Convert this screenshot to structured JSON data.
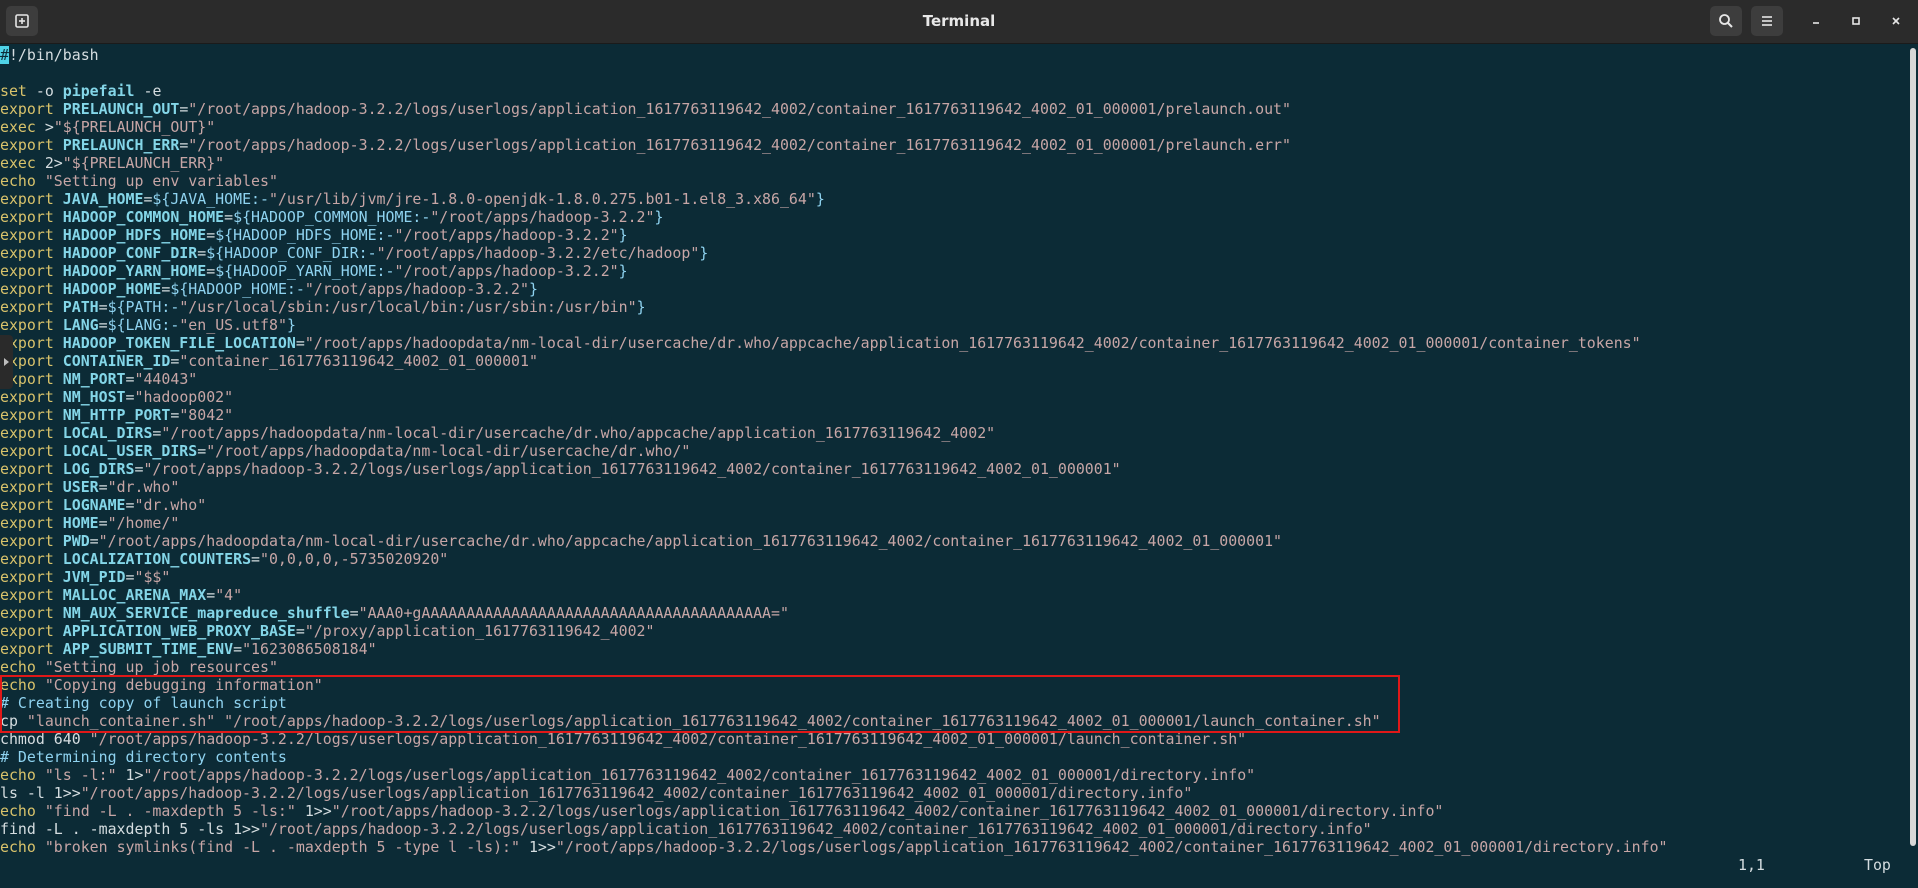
{
  "window": {
    "title": "Terminal"
  },
  "icons": {
    "new_tab": "new-tab-icon",
    "search": "search-icon",
    "menu": "menu-icon",
    "minimize": "minimize-icon",
    "maximize": "maximize-icon",
    "close": "close-icon"
  },
  "colors": {
    "background": "#0c2b36",
    "keyword": "#d9c36b",
    "variable": "#84d6e8",
    "string": "#c7a6a6",
    "comment": "#8fd3f0",
    "highlight_box": "#e01818"
  },
  "script_lines": [
    [
      [
        "cursor",
        "#"
      ],
      [
        "txt",
        "!/bin/bash"
      ]
    ],
    [],
    [
      [
        "kw",
        "set"
      ],
      [
        "txt",
        " -o "
      ],
      [
        "var",
        "pipefail"
      ],
      [
        "txt",
        " -e"
      ]
    ],
    [
      [
        "kw",
        "export"
      ],
      [
        "txt",
        " "
      ],
      [
        "var",
        "PRELAUNCH_OUT"
      ],
      [
        "txt",
        "="
      ],
      [
        "str",
        "\"/root/apps/hadoop-3.2.2/logs/userlogs/application_1617763119642_4002/container_1617763119642_4002_01_000001/prelaunch.out\""
      ]
    ],
    [
      [
        "kw",
        "exec"
      ],
      [
        "txt",
        " >"
      ],
      [
        "str",
        "\"${PRELAUNCH_OUT}\""
      ]
    ],
    [
      [
        "kw",
        "export"
      ],
      [
        "txt",
        " "
      ],
      [
        "var",
        "PRELAUNCH_ERR"
      ],
      [
        "txt",
        "="
      ],
      [
        "str",
        "\"/root/apps/hadoop-3.2.2/logs/userlogs/application_1617763119642_4002/container_1617763119642_4002_01_000001/prelaunch.err\""
      ]
    ],
    [
      [
        "kw",
        "exec"
      ],
      [
        "txt",
        " 2>"
      ],
      [
        "str",
        "\"${PRELAUNCH_ERR}\""
      ]
    ],
    [
      [
        "kw",
        "echo"
      ],
      [
        "txt",
        " "
      ],
      [
        "str",
        "\"Setting up env variables\""
      ]
    ],
    [
      [
        "kw",
        "export"
      ],
      [
        "txt",
        " "
      ],
      [
        "var",
        "JAVA_HOME"
      ],
      [
        "txt",
        "="
      ],
      [
        "ref",
        "${JAVA_HOME:-"
      ],
      [
        "str",
        "\"/usr/lib/jvm/jre-1.8.0-openjdk-1.8.0.275.b01-1.el8_3.x86_64\""
      ],
      [
        "ref",
        "}"
      ]
    ],
    [
      [
        "kw",
        "export"
      ],
      [
        "txt",
        " "
      ],
      [
        "var",
        "HADOOP_COMMON_HOME"
      ],
      [
        "txt",
        "="
      ],
      [
        "ref",
        "${HADOOP_COMMON_HOME:-"
      ],
      [
        "str",
        "\"/root/apps/hadoop-3.2.2\""
      ],
      [
        "ref",
        "}"
      ]
    ],
    [
      [
        "kw",
        "export"
      ],
      [
        "txt",
        " "
      ],
      [
        "var",
        "HADOOP_HDFS_HOME"
      ],
      [
        "txt",
        "="
      ],
      [
        "ref",
        "${HADOOP_HDFS_HOME:-"
      ],
      [
        "str",
        "\"/root/apps/hadoop-3.2.2\""
      ],
      [
        "ref",
        "}"
      ]
    ],
    [
      [
        "kw",
        "export"
      ],
      [
        "txt",
        " "
      ],
      [
        "var",
        "HADOOP_CONF_DIR"
      ],
      [
        "txt",
        "="
      ],
      [
        "ref",
        "${HADOOP_CONF_DIR:-"
      ],
      [
        "str",
        "\"/root/apps/hadoop-3.2.2/etc/hadoop\""
      ],
      [
        "ref",
        "}"
      ]
    ],
    [
      [
        "kw",
        "export"
      ],
      [
        "txt",
        " "
      ],
      [
        "var",
        "HADOOP_YARN_HOME"
      ],
      [
        "txt",
        "="
      ],
      [
        "ref",
        "${HADOOP_YARN_HOME:-"
      ],
      [
        "str",
        "\"/root/apps/hadoop-3.2.2\""
      ],
      [
        "ref",
        "}"
      ]
    ],
    [
      [
        "kw",
        "export"
      ],
      [
        "txt",
        " "
      ],
      [
        "var",
        "HADOOP_HOME"
      ],
      [
        "txt",
        "="
      ],
      [
        "ref",
        "${HADOOP_HOME:-"
      ],
      [
        "str",
        "\"/root/apps/hadoop-3.2.2\""
      ],
      [
        "ref",
        "}"
      ]
    ],
    [
      [
        "kw",
        "export"
      ],
      [
        "txt",
        " "
      ],
      [
        "var",
        "PATH"
      ],
      [
        "txt",
        "="
      ],
      [
        "ref",
        "${PATH:-"
      ],
      [
        "str",
        "\"/usr/local/sbin:/usr/local/bin:/usr/sbin:/usr/bin\""
      ],
      [
        "ref",
        "}"
      ]
    ],
    [
      [
        "kw",
        "export"
      ],
      [
        "txt",
        " "
      ],
      [
        "var",
        "LANG"
      ],
      [
        "txt",
        "="
      ],
      [
        "ref",
        "${LANG:-"
      ],
      [
        "str",
        "\"en_US.utf8\""
      ],
      [
        "ref",
        "}"
      ]
    ],
    [
      [
        "kw",
        "export"
      ],
      [
        "txt",
        " "
      ],
      [
        "var",
        "HADOOP_TOKEN_FILE_LOCATION"
      ],
      [
        "txt",
        "="
      ],
      [
        "str",
        "\"/root/apps/hadoopdata/nm-local-dir/usercache/dr.who/appcache/application_1617763119642_4002/container_1617763119642_4002_01_000001/container_tokens\""
      ]
    ],
    [
      [
        "kw",
        "export"
      ],
      [
        "txt",
        " "
      ],
      [
        "var",
        "CONTAINER_ID"
      ],
      [
        "txt",
        "="
      ],
      [
        "str",
        "\"container_1617763119642_4002_01_000001\""
      ]
    ],
    [
      [
        "kw",
        "export"
      ],
      [
        "txt",
        " "
      ],
      [
        "var",
        "NM_PORT"
      ],
      [
        "txt",
        "="
      ],
      [
        "str",
        "\"44043\""
      ]
    ],
    [
      [
        "kw",
        "export"
      ],
      [
        "txt",
        " "
      ],
      [
        "var",
        "NM_HOST"
      ],
      [
        "txt",
        "="
      ],
      [
        "str",
        "\"hadoop002\""
      ]
    ],
    [
      [
        "kw",
        "export"
      ],
      [
        "txt",
        " "
      ],
      [
        "var",
        "NM_HTTP_PORT"
      ],
      [
        "txt",
        "="
      ],
      [
        "str",
        "\"8042\""
      ]
    ],
    [
      [
        "kw",
        "export"
      ],
      [
        "txt",
        " "
      ],
      [
        "var",
        "LOCAL_DIRS"
      ],
      [
        "txt",
        "="
      ],
      [
        "str",
        "\"/root/apps/hadoopdata/nm-local-dir/usercache/dr.who/appcache/application_1617763119642_4002\""
      ]
    ],
    [
      [
        "kw",
        "export"
      ],
      [
        "txt",
        " "
      ],
      [
        "var",
        "LOCAL_USER_DIRS"
      ],
      [
        "txt",
        "="
      ],
      [
        "str",
        "\"/root/apps/hadoopdata/nm-local-dir/usercache/dr.who/\""
      ]
    ],
    [
      [
        "kw",
        "export"
      ],
      [
        "txt",
        " "
      ],
      [
        "var",
        "LOG_DIRS"
      ],
      [
        "txt",
        "="
      ],
      [
        "str",
        "\"/root/apps/hadoop-3.2.2/logs/userlogs/application_1617763119642_4002/container_1617763119642_4002_01_000001\""
      ]
    ],
    [
      [
        "kw",
        "export"
      ],
      [
        "txt",
        " "
      ],
      [
        "var",
        "USER"
      ],
      [
        "txt",
        "="
      ],
      [
        "str",
        "\"dr.who\""
      ]
    ],
    [
      [
        "kw",
        "export"
      ],
      [
        "txt",
        " "
      ],
      [
        "var",
        "LOGNAME"
      ],
      [
        "txt",
        "="
      ],
      [
        "str",
        "\"dr.who\""
      ]
    ],
    [
      [
        "kw",
        "export"
      ],
      [
        "txt",
        " "
      ],
      [
        "var",
        "HOME"
      ],
      [
        "txt",
        "="
      ],
      [
        "str",
        "\"/home/\""
      ]
    ],
    [
      [
        "kw",
        "export"
      ],
      [
        "txt",
        " "
      ],
      [
        "var",
        "PWD"
      ],
      [
        "txt",
        "="
      ],
      [
        "str",
        "\"/root/apps/hadoopdata/nm-local-dir/usercache/dr.who/appcache/application_1617763119642_4002/container_1617763119642_4002_01_000001\""
      ]
    ],
    [
      [
        "kw",
        "export"
      ],
      [
        "txt",
        " "
      ],
      [
        "var",
        "LOCALIZATION_COUNTERS"
      ],
      [
        "txt",
        "="
      ],
      [
        "str",
        "\"0,0,0,0,-5735020920\""
      ]
    ],
    [
      [
        "kw",
        "export"
      ],
      [
        "txt",
        " "
      ],
      [
        "var",
        "JVM_PID"
      ],
      [
        "txt",
        "="
      ],
      [
        "str",
        "\"$$\""
      ]
    ],
    [
      [
        "kw",
        "export"
      ],
      [
        "txt",
        " "
      ],
      [
        "var",
        "MALLOC_ARENA_MAX"
      ],
      [
        "txt",
        "="
      ],
      [
        "str",
        "\"4\""
      ]
    ],
    [
      [
        "kw",
        "export"
      ],
      [
        "txt",
        " "
      ],
      [
        "var",
        "NM_AUX_SERVICE_mapreduce_shuffle"
      ],
      [
        "txt",
        "="
      ],
      [
        "str",
        "\"AAA0+gAAAAAAAAAAAAAAAAAAAAAAAAAAAAAAAAAAAAAAA=\""
      ]
    ],
    [
      [
        "kw",
        "export"
      ],
      [
        "txt",
        " "
      ],
      [
        "var",
        "APPLICATION_WEB_PROXY_BASE"
      ],
      [
        "txt",
        "="
      ],
      [
        "str",
        "\"/proxy/application_1617763119642_4002\""
      ]
    ],
    [
      [
        "kw",
        "export"
      ],
      [
        "txt",
        " "
      ],
      [
        "var",
        "APP_SUBMIT_TIME_ENV"
      ],
      [
        "txt",
        "="
      ],
      [
        "str",
        "\"1623086508184\""
      ]
    ],
    [
      [
        "kw",
        "echo"
      ],
      [
        "txt",
        " "
      ],
      [
        "str",
        "\"Setting up job resources\""
      ]
    ],
    [
      [
        "kw",
        "echo"
      ],
      [
        "txt",
        " "
      ],
      [
        "str",
        "\"Copying debugging information\""
      ]
    ],
    [
      [
        "cm",
        "# Creating copy of launch script"
      ]
    ],
    [
      [
        "txt",
        "cp "
      ],
      [
        "str",
        "\"launch_container.sh\""
      ],
      [
        "txt",
        " "
      ],
      [
        "str",
        "\"/root/apps/hadoop-3.2.2/logs/userlogs/application_1617763119642_4002/container_1617763119642_4002_01_000001/launch_container.sh\""
      ]
    ],
    [
      [
        "txt",
        "chmod 640 "
      ],
      [
        "str",
        "\"/root/apps/hadoop-3.2.2/logs/userlogs/application_1617763119642_4002/container_1617763119642_4002_01_000001/launch_container.sh\""
      ]
    ],
    [
      [
        "cm",
        "# Determining directory contents"
      ]
    ],
    [
      [
        "kw",
        "echo"
      ],
      [
        "txt",
        " "
      ],
      [
        "str",
        "\"ls -l:\""
      ],
      [
        "txt",
        " 1>"
      ],
      [
        "str",
        "\"/root/apps/hadoop-3.2.2/logs/userlogs/application_1617763119642_4002/container_1617763119642_4002_01_000001/directory.info\""
      ]
    ],
    [
      [
        "txt",
        "ls -l 1>>"
      ],
      [
        "str",
        "\"/root/apps/hadoop-3.2.2/logs/userlogs/application_1617763119642_4002/container_1617763119642_4002_01_000001/directory.info\""
      ]
    ],
    [
      [
        "kw",
        "echo"
      ],
      [
        "txt",
        " "
      ],
      [
        "str",
        "\"find -L . -maxdepth 5 -ls:\""
      ],
      [
        "txt",
        " 1>>"
      ],
      [
        "str",
        "\"/root/apps/hadoop-3.2.2/logs/userlogs/application_1617763119642_4002/container_1617763119642_4002_01_000001/directory.info\""
      ]
    ],
    [
      [
        "txt",
        "find -L . -maxdepth 5 -ls 1>>"
      ],
      [
        "str",
        "\"/root/apps/hadoop-3.2.2/logs/userlogs/application_1617763119642_4002/container_1617763119642_4002_01_000001/directory.info\""
      ]
    ],
    [
      [
        "kw",
        "echo"
      ],
      [
        "txt",
        " "
      ],
      [
        "str",
        "\"broken symlinks(find -L . -maxdepth 5 -type l -ls):\""
      ],
      [
        "txt",
        " 1>>"
      ],
      [
        "str",
        "\"/root/apps/hadoop-3.2.2/logs/userlogs/application_1617763119642_4002/container_1617763119642_4002_01_000001/directory.info\""
      ]
    ]
  ],
  "status": {
    "cursor_position": "1,1",
    "scroll_position": "Top"
  }
}
